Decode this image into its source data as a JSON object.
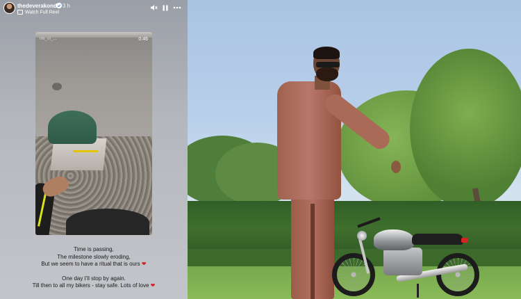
{
  "story": {
    "username": "thedeverakonda",
    "verified_badge_icon": "verified-icon",
    "time_ago": "3 h",
    "watch_label": "Watch Full Reel",
    "controls": [
      {
        "name": "mute-icon",
        "glyph": "🔇"
      },
      {
        "name": "pause-icon",
        "glyph": "⏸"
      },
      {
        "name": "more-icon",
        "glyph": "•••"
      }
    ],
    "reel_timer": "0:46",
    "reel_watermark": "life_of_..."
  },
  "caption": {
    "lines_a": [
      "Time is passing,",
      "The milestone slowly eroding,",
      "But we seem to have a ritual that is ours"
    ],
    "lines_b": [
      "One day I'll stop by again.",
      "Till then to all my bikers - stay safe. Lots of love"
    ],
    "heart": "❤"
  },
  "colors": {
    "heart": "#d8202a",
    "story_bg": "#b4b7bd",
    "sky": "#b9d0ea",
    "hedge": "#2f5f27",
    "outfit": "#a86a58"
  }
}
